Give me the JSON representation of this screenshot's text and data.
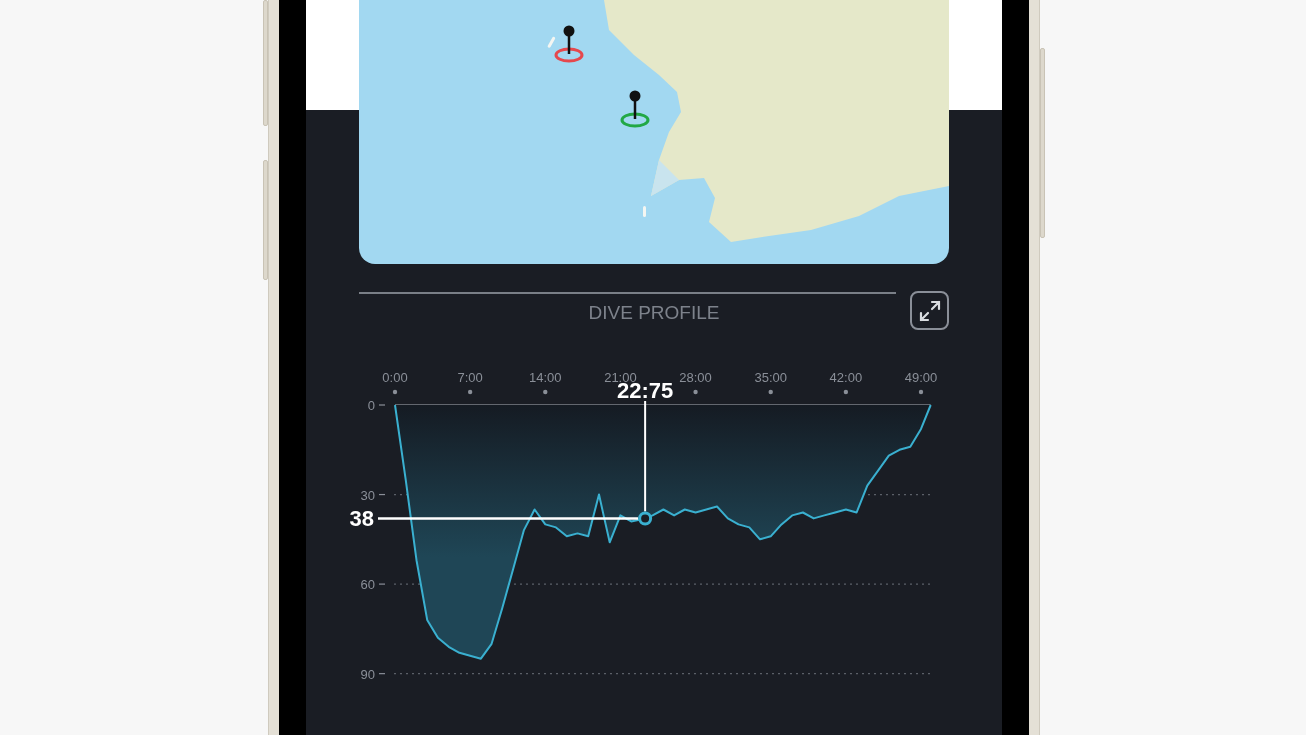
{
  "map": {
    "kind": "picture",
    "pins": [
      {
        "color": "#e5484d"
      },
      {
        "color": "#22a845"
      }
    ]
  },
  "dive_profile": {
    "title": "DIVE PROFILE",
    "chart_data": {
      "type": "area",
      "x": [
        0,
        1,
        2,
        3,
        4,
        5,
        6,
        7,
        8,
        9,
        10,
        11,
        12,
        13,
        14,
        15,
        16,
        17,
        18,
        19,
        19.5,
        20,
        21,
        22,
        23.3,
        24,
        25,
        26,
        27,
        28,
        29,
        30,
        31,
        32,
        33,
        34,
        35,
        36,
        37,
        38,
        39,
        40,
        41,
        42,
        43,
        44,
        45,
        46,
        47,
        48,
        49,
        49.9
      ],
      "series": [
        {
          "color": "#3ab0d0",
          "values": [
            0,
            25,
            52,
            72,
            78,
            81,
            83,
            84,
            85,
            80,
            68,
            55,
            42,
            35,
            40,
            41,
            44,
            43,
            44,
            30,
            38,
            46,
            37,
            39,
            38,
            37,
            35,
            37,
            35,
            36,
            35,
            34,
            38,
            40,
            41,
            45,
            44,
            40,
            37,
            36,
            38,
            37,
            36,
            35,
            36,
            27,
            22,
            17,
            15,
            14,
            8,
            0
          ]
        }
      ],
      "xlim": [
        0,
        49.9
      ],
      "ylim": [
        90,
        0
      ],
      "xticks": [
        {
          "value": 0,
          "label": "0:00"
        },
        {
          "value": 7,
          "label": "7:00"
        },
        {
          "value": 14,
          "label": "14:00"
        },
        {
          "value": 21,
          "label": "21:00"
        },
        {
          "value": 28,
          "label": "28:00"
        },
        {
          "value": 35,
          "label": "35:00"
        },
        {
          "value": 42,
          "label": "42:00"
        },
        {
          "value": 49,
          "label": "49:00"
        }
      ],
      "yticks": [
        0,
        30,
        60,
        90
      ],
      "annotations": [
        {
          "x": 23.3,
          "y": 38,
          "text": "22:75"
        },
        "38"
      ]
    }
  }
}
